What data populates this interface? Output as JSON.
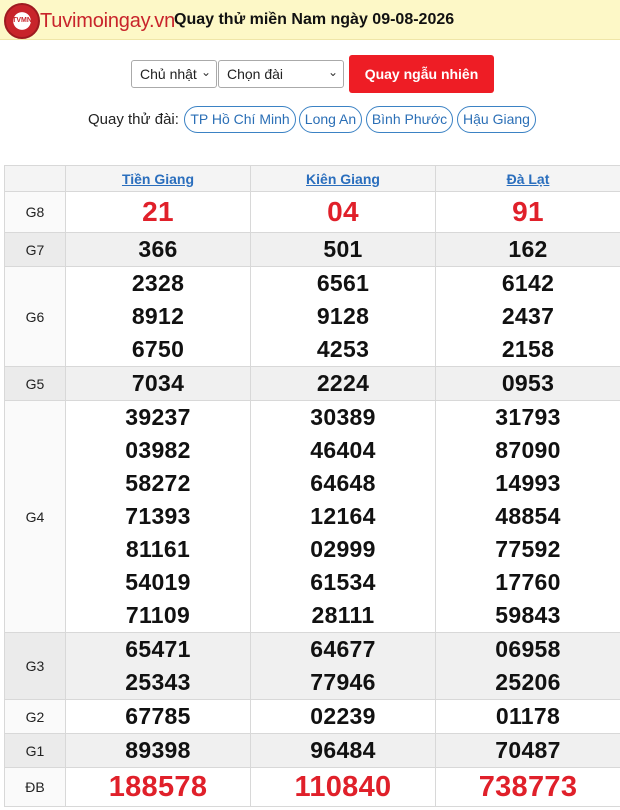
{
  "header": {
    "logo_badge": "TVMN",
    "logo_text": "Tuvimoingay.vn",
    "title": "Quay thử miền Nam ngày 09-08-2026"
  },
  "controls": {
    "day_select": "Chủ nhật",
    "station_select": "Chọn đài",
    "spin_button": "Quay ngẫu nhiên"
  },
  "stations": {
    "label": "Quay thử đài:",
    "items": [
      "TP Hồ Chí Minh",
      "Long An",
      "Bình Phước",
      "Hậu Giang"
    ]
  },
  "table": {
    "provinces": [
      "Tiền Giang",
      "Kiên Giang",
      "Đà Lạt"
    ],
    "rows": [
      {
        "prize": "G8",
        "values": [
          [
            "21"
          ],
          [
            "04"
          ],
          [
            "91"
          ]
        ]
      },
      {
        "prize": "G7",
        "values": [
          [
            "366"
          ],
          [
            "501"
          ],
          [
            "162"
          ]
        ]
      },
      {
        "prize": "G6",
        "values": [
          [
            "2328",
            "8912",
            "6750"
          ],
          [
            "6561",
            "9128",
            "4253"
          ],
          [
            "6142",
            "2437",
            "2158"
          ]
        ]
      },
      {
        "prize": "G5",
        "values": [
          [
            "7034"
          ],
          [
            "2224"
          ],
          [
            "0953"
          ]
        ]
      },
      {
        "prize": "G4",
        "values": [
          [
            "39237",
            "03982",
            "58272",
            "71393",
            "81161",
            "54019",
            "71109"
          ],
          [
            "30389",
            "46404",
            "64648",
            "12164",
            "02999",
            "61534",
            "28111"
          ],
          [
            "31793",
            "87090",
            "14993",
            "48854",
            "77592",
            "17760",
            "59843"
          ]
        ]
      },
      {
        "prize": "G3",
        "values": [
          [
            "65471",
            "25343"
          ],
          [
            "64677",
            "77946"
          ],
          [
            "06958",
            "25206"
          ]
        ]
      },
      {
        "prize": "G2",
        "values": [
          [
            "67785"
          ],
          [
            "02239"
          ],
          [
            "01178"
          ]
        ]
      },
      {
        "prize": "G1",
        "values": [
          [
            "89398"
          ],
          [
            "96484"
          ],
          [
            "70487"
          ]
        ]
      },
      {
        "prize": "ĐB",
        "values": [
          [
            "188578"
          ],
          [
            "110840"
          ],
          [
            "738773"
          ]
        ]
      }
    ]
  }
}
